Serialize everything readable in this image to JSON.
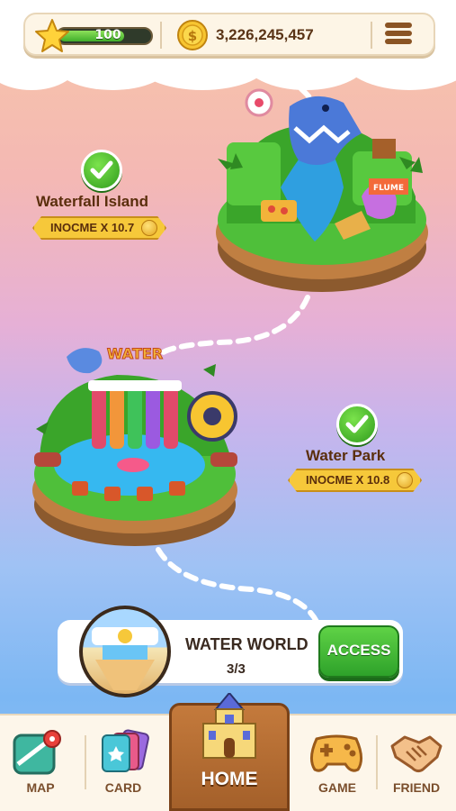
{
  "header": {
    "stars": "100",
    "star_progress": 0.72,
    "coins": "3,226,245,457",
    "menu_icon": "hamburger-menu-icon"
  },
  "islands": [
    {
      "name": "Waterfall Island",
      "income": "INOCME X 10.7",
      "completed": true
    },
    {
      "name": "Water Park",
      "income": "INOCME X 10.8",
      "completed": true
    }
  ],
  "world": {
    "title": "WATER WORLD",
    "progress": "3/3",
    "access_label": "ACCESS"
  },
  "nav": {
    "map": "MAP",
    "card": "CARD",
    "home": "HOME",
    "game": "GAME",
    "friend": "FRIEND"
  },
  "colors": {
    "accent_green": "#3fae2a",
    "gold": "#f6c83a",
    "brown": "#5a2e0c"
  }
}
